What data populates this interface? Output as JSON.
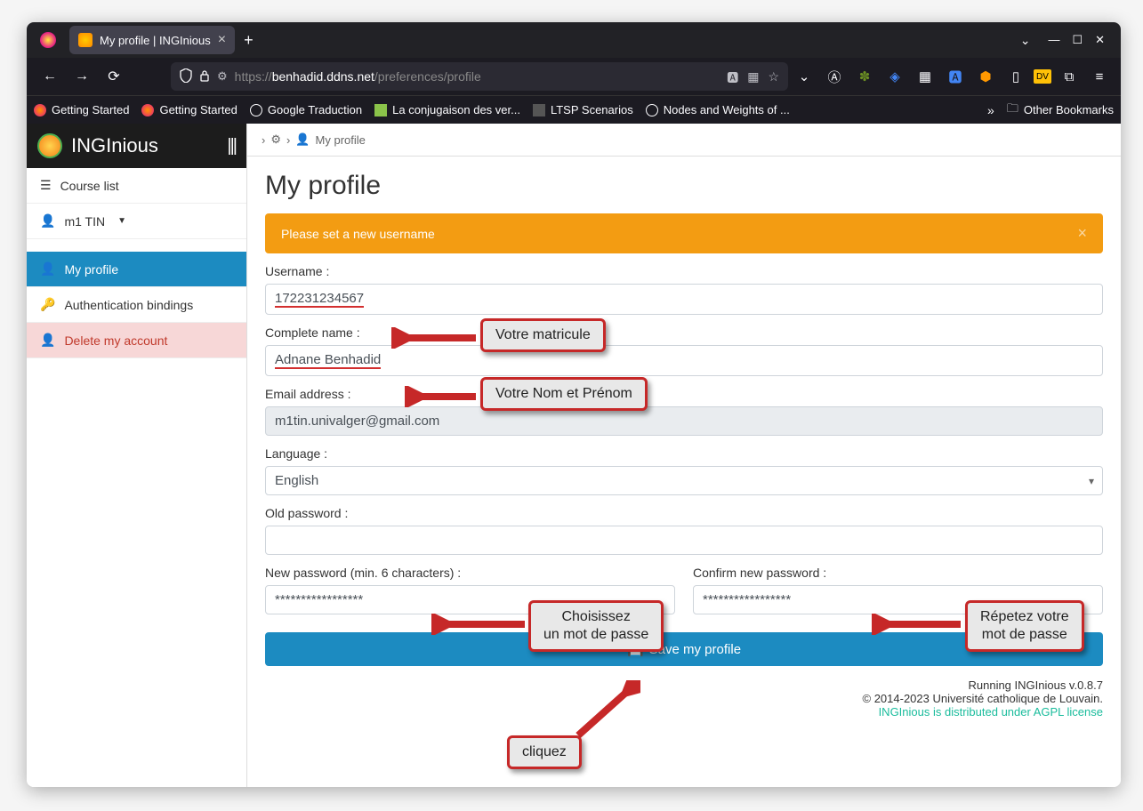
{
  "browser": {
    "tab_title": "My profile | INGInious",
    "url": "https://benhadid.ddns.net/preferences/profile",
    "bookmarks": [
      "Getting Started",
      "Getting Started",
      "Google Traduction",
      "La conjugaison des ver...",
      "LTSP Scenarios",
      "Nodes and Weights of ..."
    ],
    "other_bookmarks": "Other Bookmarks"
  },
  "sidebar": {
    "brand": "INGInious",
    "course_list": "Course list",
    "user": "m1 TIN",
    "my_profile": "My profile",
    "auth_bindings": "Authentication bindings",
    "delete_account": "Delete my account"
  },
  "breadcrumb": {
    "label": "My profile"
  },
  "page": {
    "title": "My profile",
    "alert": "Please set a new username",
    "labels": {
      "username": "Username :",
      "complete_name": "Complete name :",
      "email": "Email address :",
      "language": "Language :",
      "old_password": "Old password :",
      "new_password": "New password (min. 6 characters) :",
      "confirm_password": "Confirm new password :"
    },
    "values": {
      "username": "172231234567",
      "complete_name": "Adnane Benhadid",
      "email": "m1tin.univalger@gmail.com",
      "language": "English",
      "old_password": "",
      "new_password": "*****************",
      "confirm_password": "*****************"
    },
    "save_button": "Save my profile"
  },
  "footer": {
    "line1": "Running INGInious v.0.8.7",
    "line2": "© 2014-2023 Université catholique de Louvain.",
    "link": "INGInious is distributed under AGPL license"
  },
  "annotations": {
    "matricule": "Votre matricule",
    "nom": "Votre Nom et Prénom",
    "choose_pw": "Choisissez\nun mot de passe",
    "repeat_pw": "Répetez votre\nmot de passe",
    "click": "cliquez"
  }
}
